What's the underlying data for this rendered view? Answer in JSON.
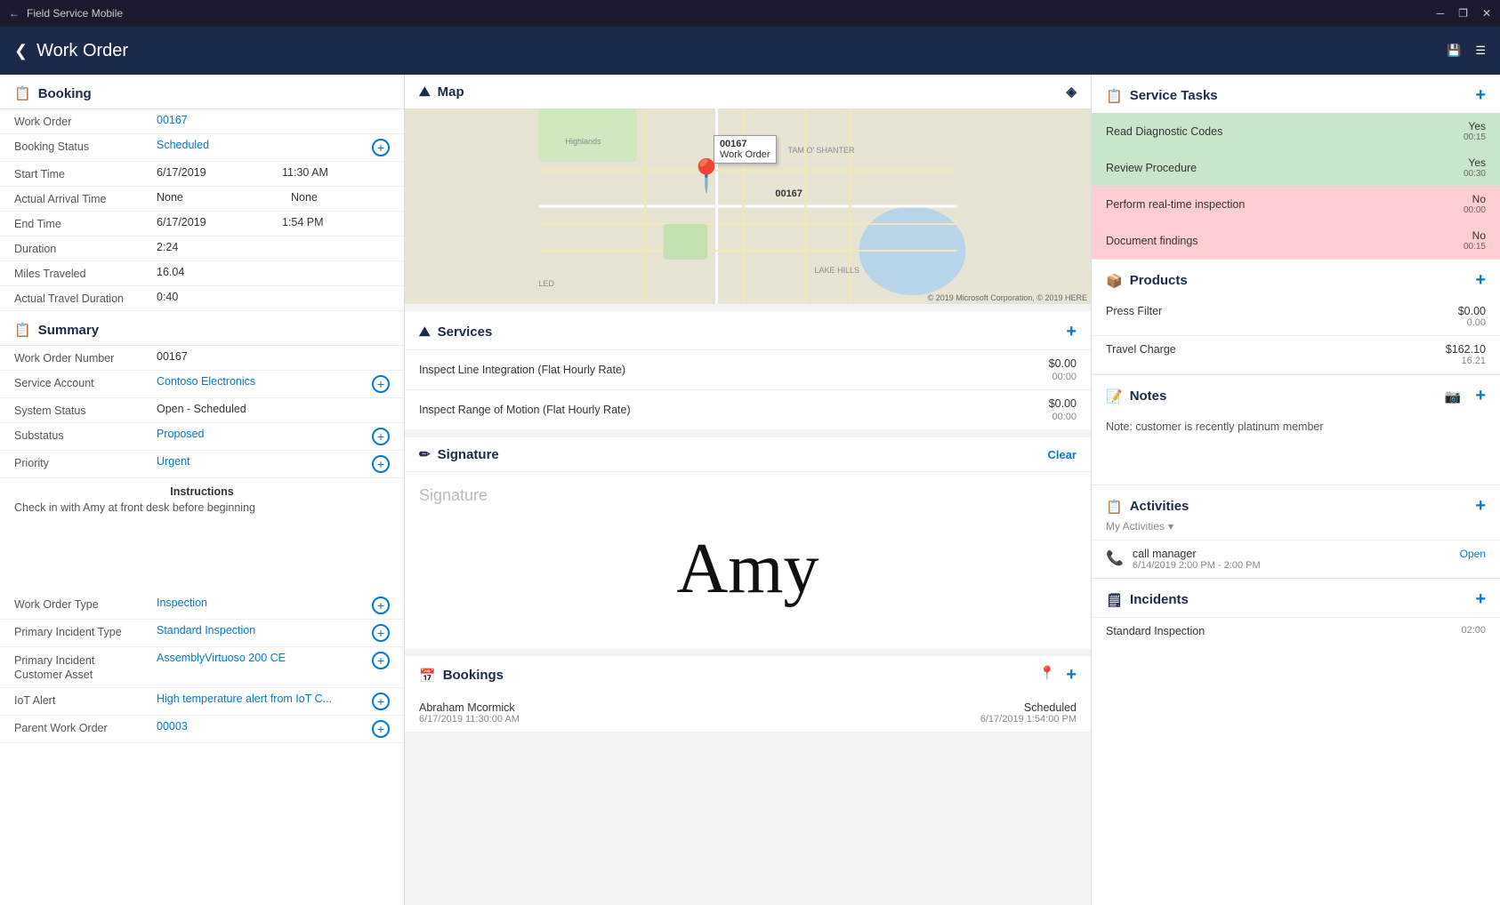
{
  "titlebar": {
    "app_name": "Field Service Mobile",
    "controls": [
      "minimize",
      "restore",
      "close"
    ]
  },
  "header": {
    "back_label": "←",
    "title": "Work Order",
    "save_icon": "💾",
    "menu_icon": "☰"
  },
  "left": {
    "booking_section": {
      "title": "Booking",
      "fields": [
        {
          "label": "Work Order",
          "value": "00167",
          "is_link": true
        },
        {
          "label": "Booking Status",
          "value": "Scheduled",
          "is_link": true
        },
        {
          "label": "Start Time",
          "value1": "6/17/2019",
          "value2": "11:30 AM"
        },
        {
          "label": "Actual Arrival Time",
          "value1": "None",
          "value2": "None"
        },
        {
          "label": "End Time",
          "value1": "6/17/2019",
          "value2": "1:54 PM"
        },
        {
          "label": "Duration",
          "value": "2:24"
        },
        {
          "label": "Miles Traveled",
          "value": "16.04"
        },
        {
          "label": "Actual Travel Duration",
          "value": "0:40"
        }
      ]
    },
    "summary_section": {
      "title": "Summary",
      "fields": [
        {
          "label": "Work Order Number",
          "value": "00167",
          "is_link": false
        },
        {
          "label": "Service Account",
          "value": "Contoso Electronics",
          "is_link": true
        },
        {
          "label": "System Status",
          "value": "Open - Scheduled",
          "is_link": false
        },
        {
          "label": "Substatus",
          "value": "Proposed",
          "is_link": true
        },
        {
          "label": "Priority",
          "value": "Urgent",
          "is_link": true
        }
      ],
      "instructions_label": "Instructions",
      "instructions_text": "Check in with Amy at front desk before beginning"
    },
    "bottom_fields": [
      {
        "label": "Work Order Type",
        "value": "Inspection",
        "is_link": true
      },
      {
        "label": "Primary Incident Type",
        "value": "Standard Inspection",
        "is_link": true
      },
      {
        "label": "Primary Incident\nCustomer Asset",
        "value": "AssemblyVirtuoso 200 CE",
        "is_link": true
      },
      {
        "label": "IoT Alert",
        "value": "High temperature alert from IoT C...",
        "is_link": true
      },
      {
        "label": "Parent Work Order",
        "value": "00003",
        "is_link": true
      }
    ]
  },
  "center": {
    "map": {
      "title": "Map",
      "tooltip_id": "00167",
      "tooltip_sub": "Work Order",
      "location_label": "00167",
      "copyright": "© 2019 Microsoft Corporation, © 2019 HERE"
    },
    "services": {
      "title": "Services",
      "items": [
        {
          "name": "Inspect Line Integration (Flat Hourly Rate)",
          "price": "$0.00",
          "time": "00:00"
        },
        {
          "name": "Inspect Range of Motion (Flat Hourly Rate)",
          "price": "$0.00",
          "time": "00:00"
        }
      ]
    },
    "signature": {
      "title": "Signature",
      "placeholder": "Signature",
      "clear_label": "Clear",
      "signature_text": "Amy"
    },
    "bookings": {
      "title": "Bookings",
      "items": [
        {
          "name": "Abraham Mcormick",
          "date": "6/17/2019 11:30:00 AM",
          "status": "Scheduled",
          "status_date": "6/17/2019 1:54:00 PM"
        }
      ]
    }
  },
  "right": {
    "service_tasks": {
      "title": "Service Tasks",
      "items": [
        {
          "name": "Read Diagnostic Codes",
          "status": "Yes",
          "time": "00:15",
          "color": "green"
        },
        {
          "name": "Review Procedure",
          "status": "Yes",
          "time": "00:30",
          "color": "green"
        },
        {
          "name": "Perform real-time inspection",
          "status": "No",
          "time": "00:00",
          "color": "red"
        },
        {
          "name": "Document findings",
          "status": "No",
          "time": "00:15",
          "color": "red"
        }
      ]
    },
    "products": {
      "title": "Products",
      "items": [
        {
          "name": "Press Filter",
          "price": "$0.00",
          "qty": "0.00"
        },
        {
          "name": "Travel Charge",
          "price": "$162.10",
          "qty": "16.21"
        }
      ]
    },
    "notes": {
      "title": "Notes",
      "content": "Note: customer is recently platinum member"
    },
    "activities": {
      "title": "Activities",
      "sub_label": "My Activities",
      "items": [
        {
          "name": "call manager",
          "date": "6/14/2019 2:00 PM - 2:00 PM",
          "status": "Open"
        }
      ]
    },
    "incidents": {
      "title": "Incidents",
      "items": [
        {
          "name": "Standard Inspection",
          "time": "02:00"
        }
      ]
    }
  }
}
